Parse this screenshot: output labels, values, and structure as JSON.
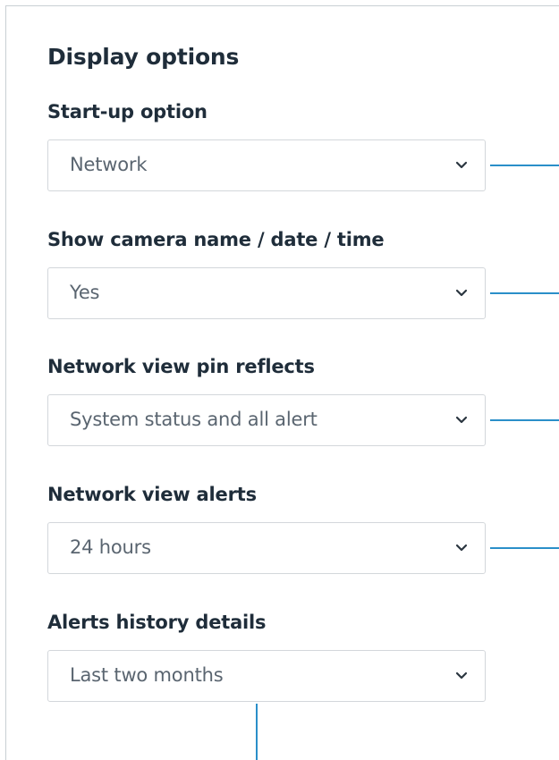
{
  "section": {
    "title": "Display options"
  },
  "fields": [
    {
      "label": "Start-up option",
      "value": "Network"
    },
    {
      "label": "Show camera name / date / time",
      "value": "Yes"
    },
    {
      "label": "Network view pin reflects",
      "value": "System status and all alert"
    },
    {
      "label": "Network view alerts",
      "value": "24 hours"
    },
    {
      "label": "Alerts history details",
      "value": "Last two months"
    }
  ],
  "icons": {
    "dropdown": "chevron-down-icon"
  },
  "colors": {
    "accent_line": "#2a8fc9",
    "heading_text": "#1f2d3a",
    "value_text": "#5a6570",
    "border": "#d3d7db"
  }
}
